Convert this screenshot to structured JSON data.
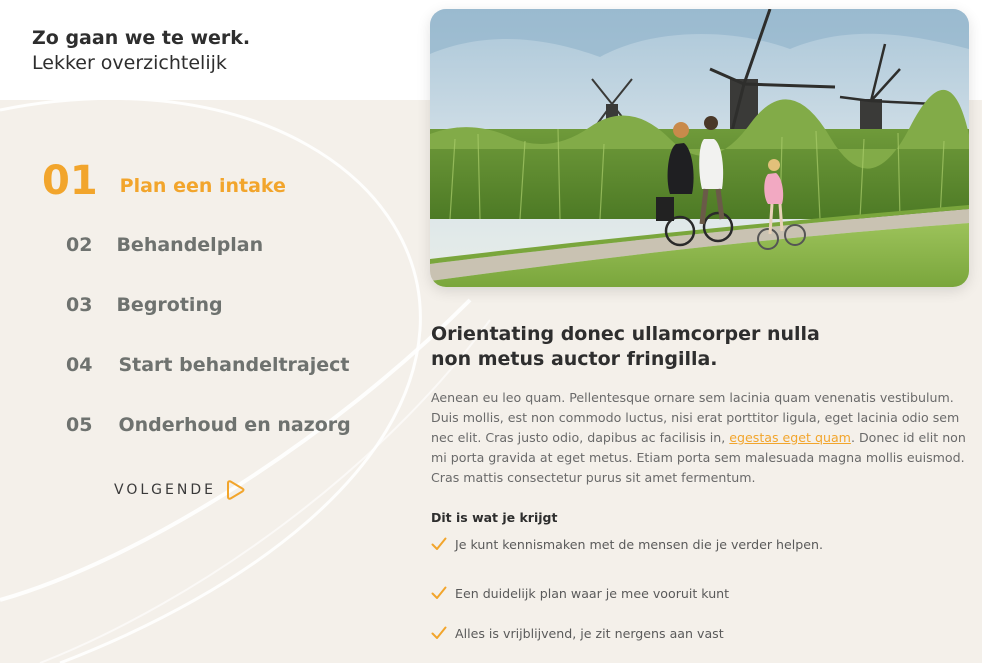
{
  "header": {
    "title": "Zo gaan we te werk.",
    "subtitle": "Lekker overzichtelijk"
  },
  "steps": [
    {
      "number": "01",
      "label": "Plan een intake",
      "active": true
    },
    {
      "number": "02",
      "label": "Behandelplan",
      "active": false
    },
    {
      "number": "03",
      "label": "Begroting",
      "active": false
    },
    {
      "number": "04",
      "label": "Start behandeltraject",
      "active": false
    },
    {
      "number": "05",
      "label": "Onderhoud en nazorg",
      "active": false
    }
  ],
  "next": {
    "label": "VOLGENDE",
    "icon": "play-outline-icon"
  },
  "photo": {
    "icon": "cycling-windmills-photo"
  },
  "content": {
    "heading": "Orientating donec ullamcorper nulla non metus auctor fringilla.",
    "para_part1": "Aenean eu leo quam. Pellentesque ornare sem lacinia quam venenatis vestibulum. Duis mollis, est non commodo luctus, nisi erat porttitor ligula, eget lacinia odio sem nec elit. Cras justo odio, dapibus ac facilisis in, ",
    "para_link": "egestas eget quam",
    "para_part2": ". Donec id elit non mi porta gravida at eget metus. Etiam porta sem malesuada magna mollis euismod. Cras mattis consectetur purus sit amet fermentum.",
    "subheading": "Dit is wat je krijgt",
    "benefits": [
      "Je kunt kennismaken met de mensen die je verder helpen.",
      "Een duidelijk plan waar je mee vooruit kunt",
      "Alles is vrijblijvend, je zit nergens aan vast"
    ]
  },
  "colors": {
    "accent": "#f2a52c",
    "background": "#f4f0ea",
    "muted": "#6e726f"
  }
}
